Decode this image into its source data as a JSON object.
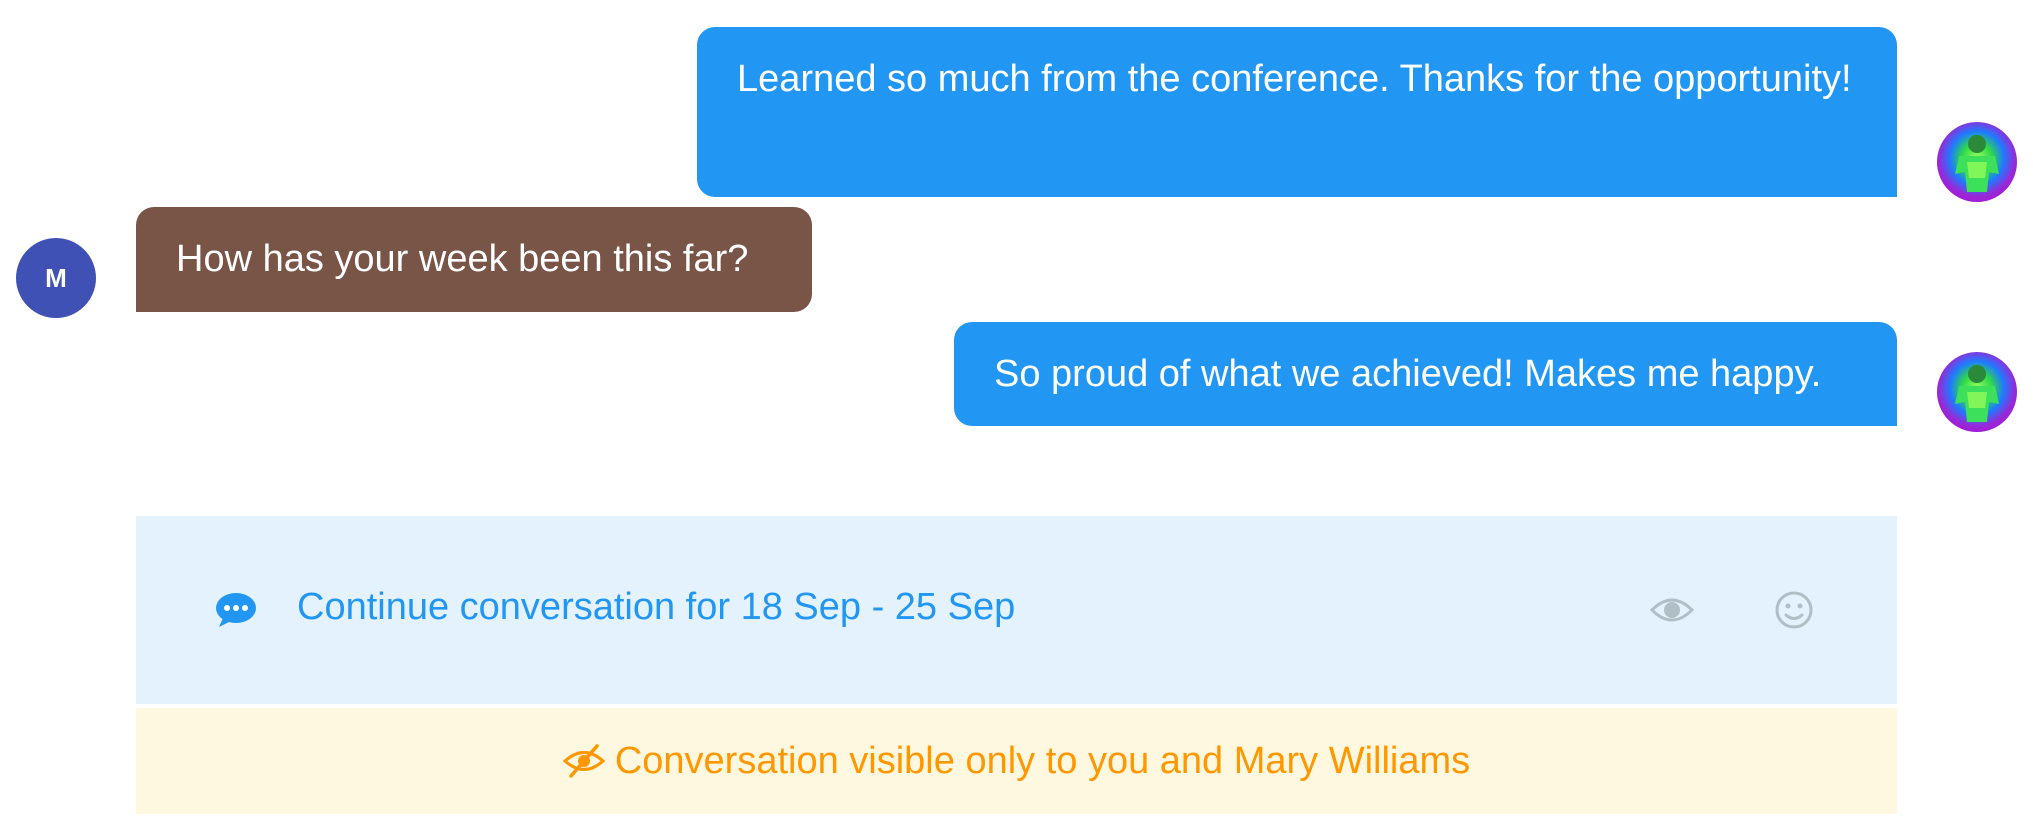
{
  "messages": [
    {
      "side": "me",
      "text": "Learned so much from the conference. Thanks for the opportunity!"
    },
    {
      "side": "them",
      "text": "How has your week been this far?"
    },
    {
      "side": "me",
      "text": "So proud of what we achieved! Makes me happy."
    }
  ],
  "contact": {
    "initial": "M",
    "avatar_color": "#3f51b5"
  },
  "colors": {
    "my_bubble": "#2196f3",
    "their_bubble": "#795548",
    "continue_bg": "#e3f2fd",
    "notice_bg": "#fff8e1",
    "notice_text": "#ff9800"
  },
  "continue_bar": {
    "icon": "chat-bubble-icon",
    "label": "Continue conversation for 18 Sep - 25 Sep",
    "actions": [
      "eye-icon",
      "smile-icon"
    ]
  },
  "notice": {
    "icon": "eye-slash-icon",
    "text": "Conversation visible only to you and Mary Williams"
  }
}
